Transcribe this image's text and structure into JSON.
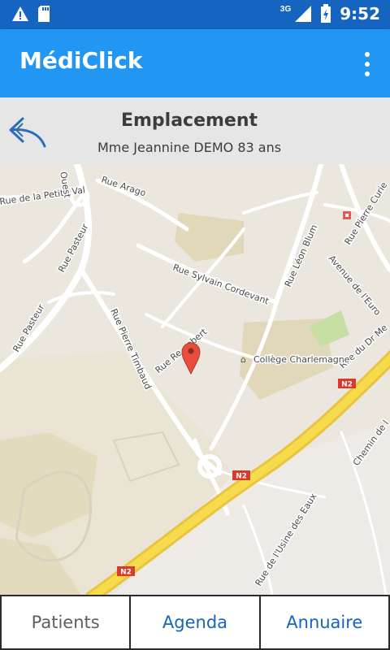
{
  "status_bar": {
    "time": "9:52",
    "network": "3G"
  },
  "app_bar": {
    "title": "MédiClick"
  },
  "header": {
    "title": "Emplacement",
    "subtitle": "Mme Jeannine DEMO 83 ans"
  },
  "map": {
    "streets": [
      "Rue Arago",
      "Rue Pasteur",
      "Rue Pasteur",
      "Rue Sylvain Cordevant",
      "Rue Léon Blum",
      "Rue Pierre Curie",
      "Avenue de l'Euro",
      "Rue Pierre Timbaud",
      "Rue Re…ebert",
      "Rue du Dr Me",
      "Chemin de l",
      "Rue de la Petite Val",
      "Ouest",
      "Rue de l'Usine des Eaux"
    ],
    "poi": "Collège Charlemagne",
    "road_shields": [
      "N2",
      "N2",
      "N2"
    ]
  },
  "bottom_nav": {
    "patients": "Patients",
    "agenda": "Agenda",
    "annuaire": "Annuaire"
  }
}
